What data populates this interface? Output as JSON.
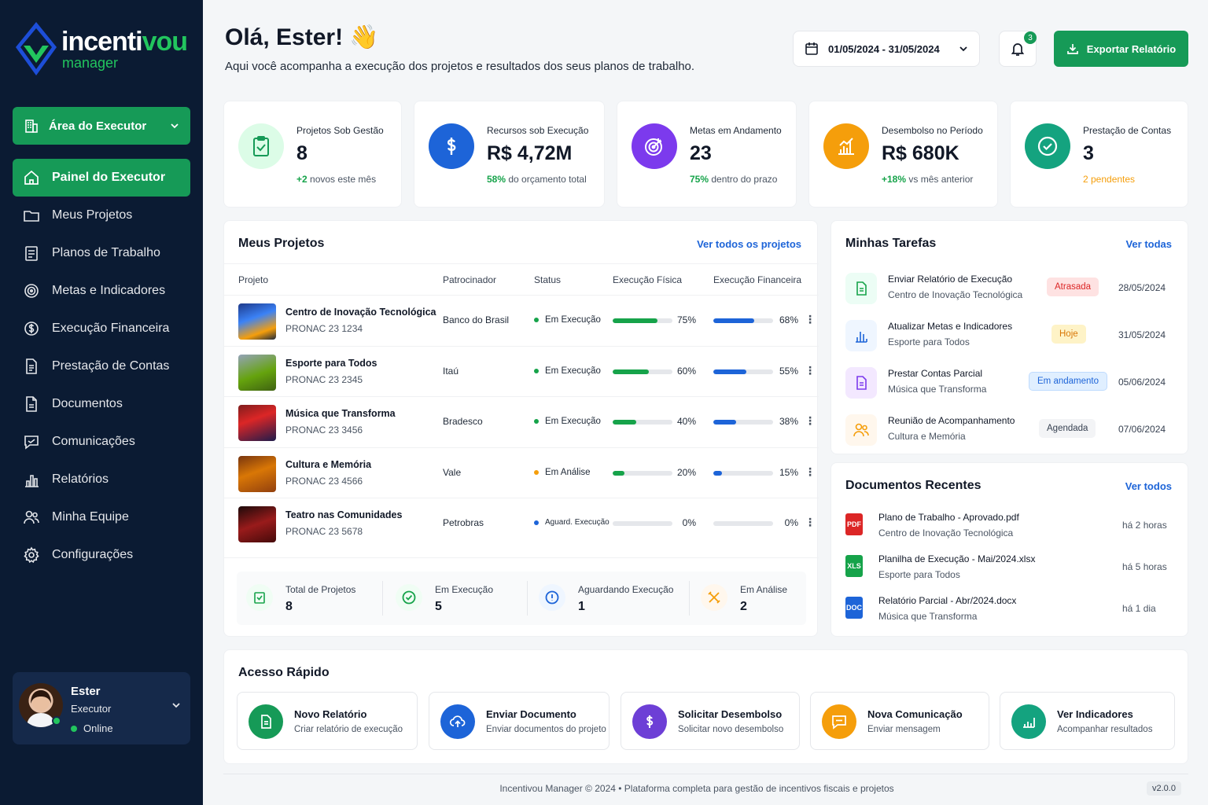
{
  "brand": {
    "name_part1": "incenti",
    "name_part2": "vou",
    "sub": "manager"
  },
  "sidebar": {
    "area": "Área do Executor",
    "items": [
      {
        "label": "Painel do Executor",
        "icon": "home-icon"
      },
      {
        "label": "Meus Projetos",
        "icon": "folder-icon"
      },
      {
        "label": "Planos de Trabalho",
        "icon": "clipboard-icon"
      },
      {
        "label": "Metas e Indicadores",
        "icon": "target-icon"
      },
      {
        "label": "Execução Financeira",
        "icon": "dollar-icon"
      },
      {
        "label": "Prestação de Contas",
        "icon": "document-icon"
      },
      {
        "label": "Documentos",
        "icon": "file-icon"
      },
      {
        "label": "Comunicações",
        "icon": "chat-icon"
      },
      {
        "label": "Relatórios",
        "icon": "chart-icon"
      },
      {
        "label": "Minha Equipe",
        "icon": "users-icon"
      },
      {
        "label": "Configurações",
        "icon": "gear-icon"
      }
    ],
    "user": {
      "name": "Ester",
      "role": "Executor",
      "status": "Online"
    }
  },
  "header": {
    "greeting": "Olá, Ester! 👋",
    "subtitle": "Aqui você acompanha a execução dos projetos e resultados dos seus planos de trabalho.",
    "date_range": "01/05/2024 - 31/05/2024",
    "notifications": "3",
    "export_label": "Exportar Relatório"
  },
  "kpis": [
    {
      "label": "Projetos Sob Gestão",
      "value": "8",
      "note_strong": "+2",
      "note": " novos este mês",
      "color": "#22c55e"
    },
    {
      "label": "Recursos sob Execução",
      "value": "R$ 4,72M",
      "note_strong": "58%",
      "note": " do orçamento total",
      "color": "#1d64d8"
    },
    {
      "label": "Metas em Andamento",
      "value": "23",
      "note_strong": "75%",
      "note": " dentro do prazo",
      "color": "#7c3aed"
    },
    {
      "label": "Desembolso no Período",
      "value": "R$ 680K",
      "note_strong": "+18%",
      "note": " vs mês anterior",
      "color": "#f59e0b"
    },
    {
      "label": "Prestação de Contas",
      "value": "3",
      "note_strong": "2 pendentes",
      "note": "",
      "color": "#14a37f"
    }
  ],
  "projects": {
    "title": "Meus Projetos",
    "link": "Ver todos os projetos",
    "columns": [
      "Projeto",
      "Patrocinador",
      "Status",
      "Execução Física",
      "Execução Financeira"
    ],
    "rows": [
      {
        "name": "Centro de Inovação Tecnológica",
        "code": "PRONAC 23 1234",
        "sponsor": "Banco do Brasil",
        "status": "Em Execução",
        "status_color": "#16a34a",
        "fis": 75,
        "fis_label": "75%",
        "fin": 68,
        "fin_label": "68%"
      },
      {
        "name": "Esporte para Todos",
        "code": "PRONAC 23 2345",
        "sponsor": "Itaú",
        "status": "Em Execução",
        "status_color": "#16a34a",
        "fis": 60,
        "fis_label": "60%",
        "fin": 55,
        "fin_label": "55%"
      },
      {
        "name": "Música que Transforma",
        "code": "PRONAC 23 3456",
        "sponsor": "Bradesco",
        "status": "Em Execução",
        "status_color": "#16a34a",
        "fis": 40,
        "fis_label": "40%",
        "fin": 38,
        "fin_label": "38%"
      },
      {
        "name": "Cultura e Memória",
        "code": "PRONAC 23 4566",
        "sponsor": "Vale",
        "status": "Em Análise",
        "status_color": "#f59e0b",
        "fis": 20,
        "fis_label": "20%",
        "fin": 15,
        "fin_label": "15%"
      },
      {
        "name": "Teatro nas Comunidades",
        "code": "PRONAC 23 5678",
        "sponsor": "Petrobras",
        "status": "Aguard. Execução",
        "status_color": "#1d64d8",
        "fis": 0,
        "fis_label": "0%",
        "fin": 0,
        "fin_label": "0%"
      }
    ],
    "summary": [
      {
        "label": "Total de Projetos",
        "value": "8",
        "color": "#16a34a"
      },
      {
        "label": "Em Execução",
        "value": "5",
        "color": "#16a34a"
      },
      {
        "label": "Aguardando Execução",
        "value": "1",
        "color": "#1d64d8"
      },
      {
        "label": "Em Análise",
        "value": "2",
        "color": "#f59e0b"
      }
    ]
  },
  "tasks": {
    "title": "Minhas Tarefas",
    "link": "Ver todas",
    "items": [
      {
        "title": "Enviar Relatório de Execução",
        "sub": "Centro de Inovação Tecnológica",
        "badge": "Atrasada",
        "date": "28/05/2024"
      },
      {
        "title": "Atualizar Metas e Indicadores",
        "sub": "Esporte para Todos",
        "badge": "Hoje",
        "date": "31/05/2024"
      },
      {
        "title": "Prestar Contas Parcial",
        "sub": "Música que Transforma",
        "badge": "Em andamento",
        "date": "05/06/2024"
      },
      {
        "title": "Reunião de Acompanhamento",
        "sub": "Cultura e Memória",
        "badge": "Agendada",
        "date": "07/06/2024"
      }
    ]
  },
  "documents": {
    "title": "Documentos Recentes",
    "link": "Ver todos",
    "items": [
      {
        "name": "Plano de Trabalho - Aprovado.pdf",
        "project": "Centro de Inovação Tecnológica",
        "when": "há 2 horas",
        "type": "PDF"
      },
      {
        "name": "Planilha de Execução - Mai/2024.xlsx",
        "project": "Esporte para Todos",
        "when": "há 5 horas",
        "type": "XLS"
      },
      {
        "name": "Relatório Parcial - Abr/2024.docx",
        "project": "Música que Transforma",
        "when": "há 1 dia",
        "type": "DOC"
      }
    ]
  },
  "quick": {
    "title": "Acesso Rápido",
    "items": [
      {
        "title": "Novo Relatório",
        "sub": "Criar relatório de execução",
        "color": "#169a57"
      },
      {
        "title": "Enviar Documento",
        "sub": "Enviar documentos do projeto",
        "color": "#1d64d8"
      },
      {
        "title": "Solicitar Desembolso",
        "sub": "Solicitar novo desembolso",
        "color": "#6d3fd6"
      },
      {
        "title": "Nova Comunicação",
        "sub": "Enviar mensagem",
        "color": "#f59e0b"
      },
      {
        "title": "Ver Indicadores",
        "sub": "Acompanhar resultados",
        "color": "#14a37f"
      }
    ]
  },
  "footer": {
    "text": "Incentivou Manager © 2024  •  Plataforma completa para gestão de incentivos fiscais e projetos",
    "version": "v2.0.0"
  }
}
